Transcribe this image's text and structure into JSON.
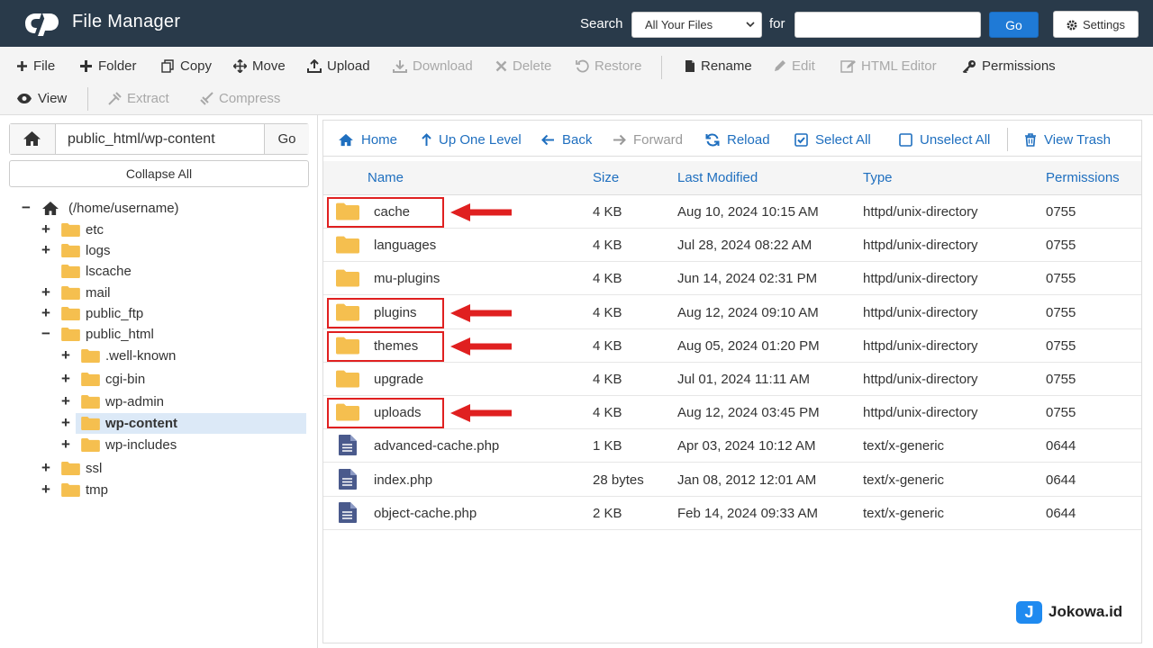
{
  "header": {
    "title": "File Manager",
    "search_label": "Search",
    "search_scope": "All Your Files",
    "for_label": "for",
    "search_value": "",
    "go_label": "Go",
    "settings_label": "Settings"
  },
  "toolbar": {
    "items": [
      {
        "label": "File",
        "icon": "plus-icon",
        "enabled": true
      },
      {
        "label": "Folder",
        "icon": "plus-icon",
        "enabled": true
      },
      {
        "label": "Copy",
        "icon": "copy-icon",
        "enabled": true
      },
      {
        "label": "Move",
        "icon": "move-icon",
        "enabled": true
      },
      {
        "label": "Upload",
        "icon": "upload-icon",
        "enabled": true
      },
      {
        "label": "Download",
        "icon": "download-icon",
        "enabled": false
      },
      {
        "label": "Delete",
        "icon": "delete-icon",
        "enabled": false
      },
      {
        "label": "Restore",
        "icon": "restore-icon",
        "enabled": false
      },
      {
        "label": "Rename",
        "icon": "rename-icon",
        "enabled": true
      },
      {
        "label": "Edit",
        "icon": "pencil-icon",
        "enabled": false
      },
      {
        "label": "HTML Editor",
        "icon": "html-editor-icon",
        "enabled": false
      },
      {
        "label": "Permissions",
        "icon": "key-icon",
        "enabled": true
      },
      {
        "label": "View",
        "icon": "eye-icon",
        "enabled": true
      },
      {
        "label": "Extract",
        "icon": "extract-icon",
        "enabled": false
      },
      {
        "label": "Compress",
        "icon": "compress-icon",
        "enabled": false
      }
    ]
  },
  "sidebar": {
    "path_value": "public_html/wp-content",
    "go_label": "Go",
    "collapse_label": "Collapse All",
    "tree": [
      {
        "label": "(/home/username)",
        "toggle": "−",
        "type": "home"
      },
      {
        "label": "etc",
        "toggle": "+"
      },
      {
        "label": "logs",
        "toggle": "+"
      },
      {
        "label": "lscache",
        "toggle": ""
      },
      {
        "label": "mail",
        "toggle": "+"
      },
      {
        "label": "public_ftp",
        "toggle": "+"
      },
      {
        "label": "public_html",
        "toggle": "−"
      },
      {
        "label": ".well-known",
        "toggle": "+"
      },
      {
        "label": "cgi-bin",
        "toggle": "+"
      },
      {
        "label": "wp-admin",
        "toggle": "+"
      },
      {
        "label": "wp-content",
        "toggle": "+",
        "selected": true
      },
      {
        "label": "wp-includes",
        "toggle": "+"
      },
      {
        "label": "ssl",
        "toggle": "+"
      },
      {
        "label": "tmp",
        "toggle": "+"
      }
    ]
  },
  "nav": {
    "home": "Home",
    "up_one_level": "Up One Level",
    "back": "Back",
    "forward": "Forward",
    "reload": "Reload",
    "select_all": "Select All",
    "unselect_all": "Unselect All",
    "view_trash": "View Trash"
  },
  "table": {
    "columns": {
      "name": "Name",
      "size": "Size",
      "modified": "Last Modified",
      "type": "Type",
      "permissions": "Permissions"
    },
    "rows": [
      {
        "name": "cache",
        "size": "4 KB",
        "modified": "Aug 10, 2024 10:15 AM",
        "type": "httpd/unix-directory",
        "perm": "0755",
        "kind": "folder",
        "highlighted": true
      },
      {
        "name": "languages",
        "size": "4 KB",
        "modified": "Jul 28, 2024 08:22 AM",
        "type": "httpd/unix-directory",
        "perm": "0755",
        "kind": "folder",
        "highlighted": false
      },
      {
        "name": "mu-plugins",
        "size": "4 KB",
        "modified": "Jun 14, 2024 02:31 PM",
        "type": "httpd/unix-directory",
        "perm": "0755",
        "kind": "folder",
        "highlighted": false
      },
      {
        "name": "plugins",
        "size": "4 KB",
        "modified": "Aug 12, 2024 09:10 AM",
        "type": "httpd/unix-directory",
        "perm": "0755",
        "kind": "folder",
        "highlighted": true
      },
      {
        "name": "themes",
        "size": "4 KB",
        "modified": "Aug 05, 2024 01:20 PM",
        "type": "httpd/unix-directory",
        "perm": "0755",
        "kind": "folder",
        "highlighted": true
      },
      {
        "name": "upgrade",
        "size": "4 KB",
        "modified": "Jul 01, 2024 11:11 AM",
        "type": "httpd/unix-directory",
        "perm": "0755",
        "kind": "folder",
        "highlighted": false
      },
      {
        "name": "uploads",
        "size": "4 KB",
        "modified": "Aug 12, 2024 03:45 PM",
        "type": "httpd/unix-directory",
        "perm": "0755",
        "kind": "folder",
        "highlighted": true
      },
      {
        "name": "advanced-cache.php",
        "size": "1 KB",
        "modified": "Apr 03, 2024 10:12 AM",
        "type": "text/x-generic",
        "perm": "0644",
        "kind": "file",
        "highlighted": false
      },
      {
        "name": "index.php",
        "size": "28 bytes",
        "modified": "Jan 08, 2012 12:01 AM",
        "type": "text/x-generic",
        "perm": "0644",
        "kind": "file",
        "highlighted": false
      },
      {
        "name": "object-cache.php",
        "size": "2 KB",
        "modified": "Feb 14, 2024 09:33 AM",
        "type": "text/x-generic",
        "perm": "0644",
        "kind": "file",
        "highlighted": false
      }
    ]
  },
  "watermark": {
    "badge": "J",
    "text": "Jokowa.id"
  },
  "colors": {
    "header_bg": "#293a4a",
    "accent": "#1f7ad6",
    "link": "#1f6fbf",
    "folder": "#f5bf4f",
    "highlight": "#e02020"
  }
}
